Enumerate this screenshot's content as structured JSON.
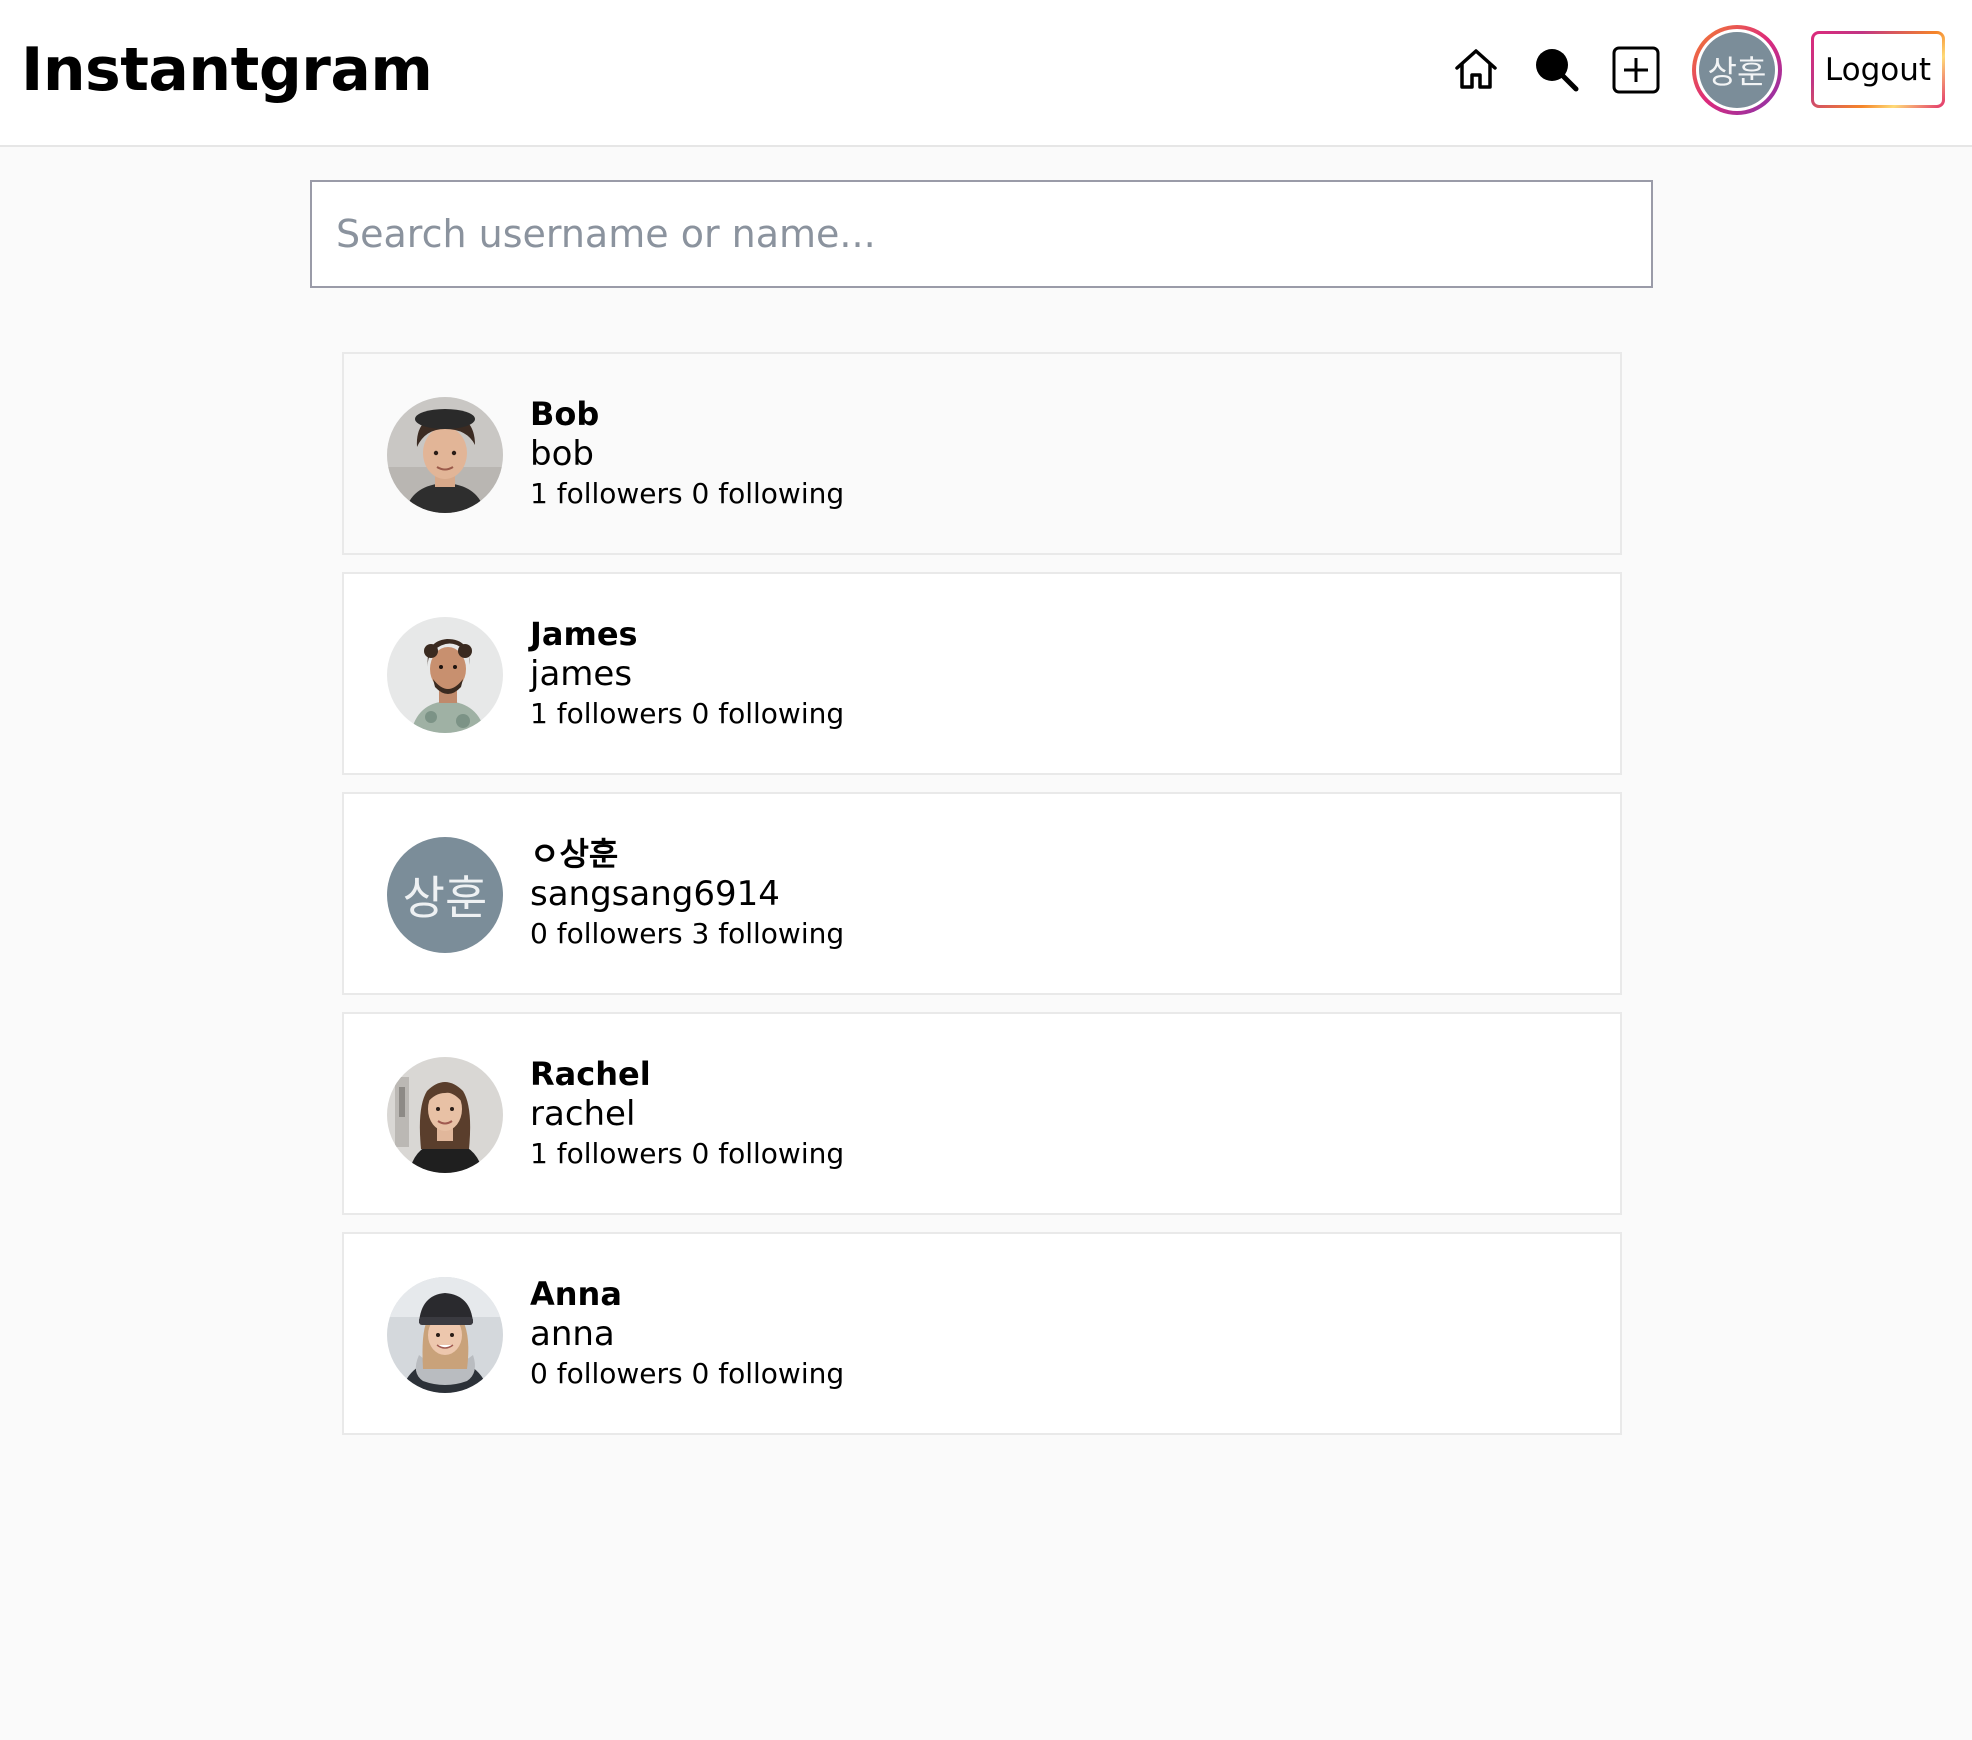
{
  "header": {
    "brand": "Instantgram",
    "nav": {
      "home_icon": "home-icon",
      "search_icon": "search-icon",
      "add_icon": "plus-square-icon",
      "avatar_initials": "상훈"
    },
    "logout_label": "Logout"
  },
  "search": {
    "placeholder": "Search username or name...",
    "value": ""
  },
  "users": [
    {
      "name": "Bob",
      "username": "bob",
      "stats": "1 followers 0 following",
      "avatar": "photo"
    },
    {
      "name": "James",
      "username": "james",
      "stats": "1 followers 0 following",
      "avatar": "photo"
    },
    {
      "name": "ㅇ상훈",
      "username": "sangsang6914",
      "stats": "0 followers 3 following",
      "avatar": "initials",
      "initials": "상훈"
    },
    {
      "name": "Rachel",
      "username": "rachel",
      "stats": "1 followers 0 following",
      "avatar": "photo"
    },
    {
      "name": "Anna",
      "username": "anna",
      "stats": "0 followers 0 following",
      "avatar": "photo"
    }
  ],
  "colors": {
    "avatar_gray": "#7b8d99",
    "card_border": "#e9e9e9",
    "page_bg": "#fafafa"
  }
}
